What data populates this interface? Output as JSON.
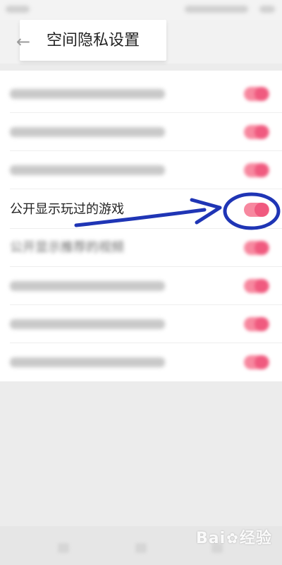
{
  "header": {
    "title": "空间隐私设置",
    "back_icon": "back-arrow-icon"
  },
  "settings": {
    "items": [
      {
        "label": "",
        "enabled": true,
        "blurred": true
      },
      {
        "label": "",
        "enabled": true,
        "blurred": true
      },
      {
        "label": "",
        "enabled": true,
        "blurred": true
      },
      {
        "label": "公开显示玩过的游戏",
        "enabled": true,
        "blurred": false
      },
      {
        "label": "公开显示推荐的视频",
        "enabled": true,
        "blurred": true
      },
      {
        "label": "",
        "enabled": true,
        "blurred": true
      },
      {
        "label": "",
        "enabled": true,
        "blurred": true
      },
      {
        "label": "",
        "enabled": true,
        "blurred": true
      }
    ]
  },
  "colors": {
    "toggle_track": "#f7889f",
    "toggle_knob": "#f05a7f",
    "annotation": "#1f35b5"
  },
  "watermark": {
    "text_left": "Bai",
    "text_right": "经验"
  }
}
